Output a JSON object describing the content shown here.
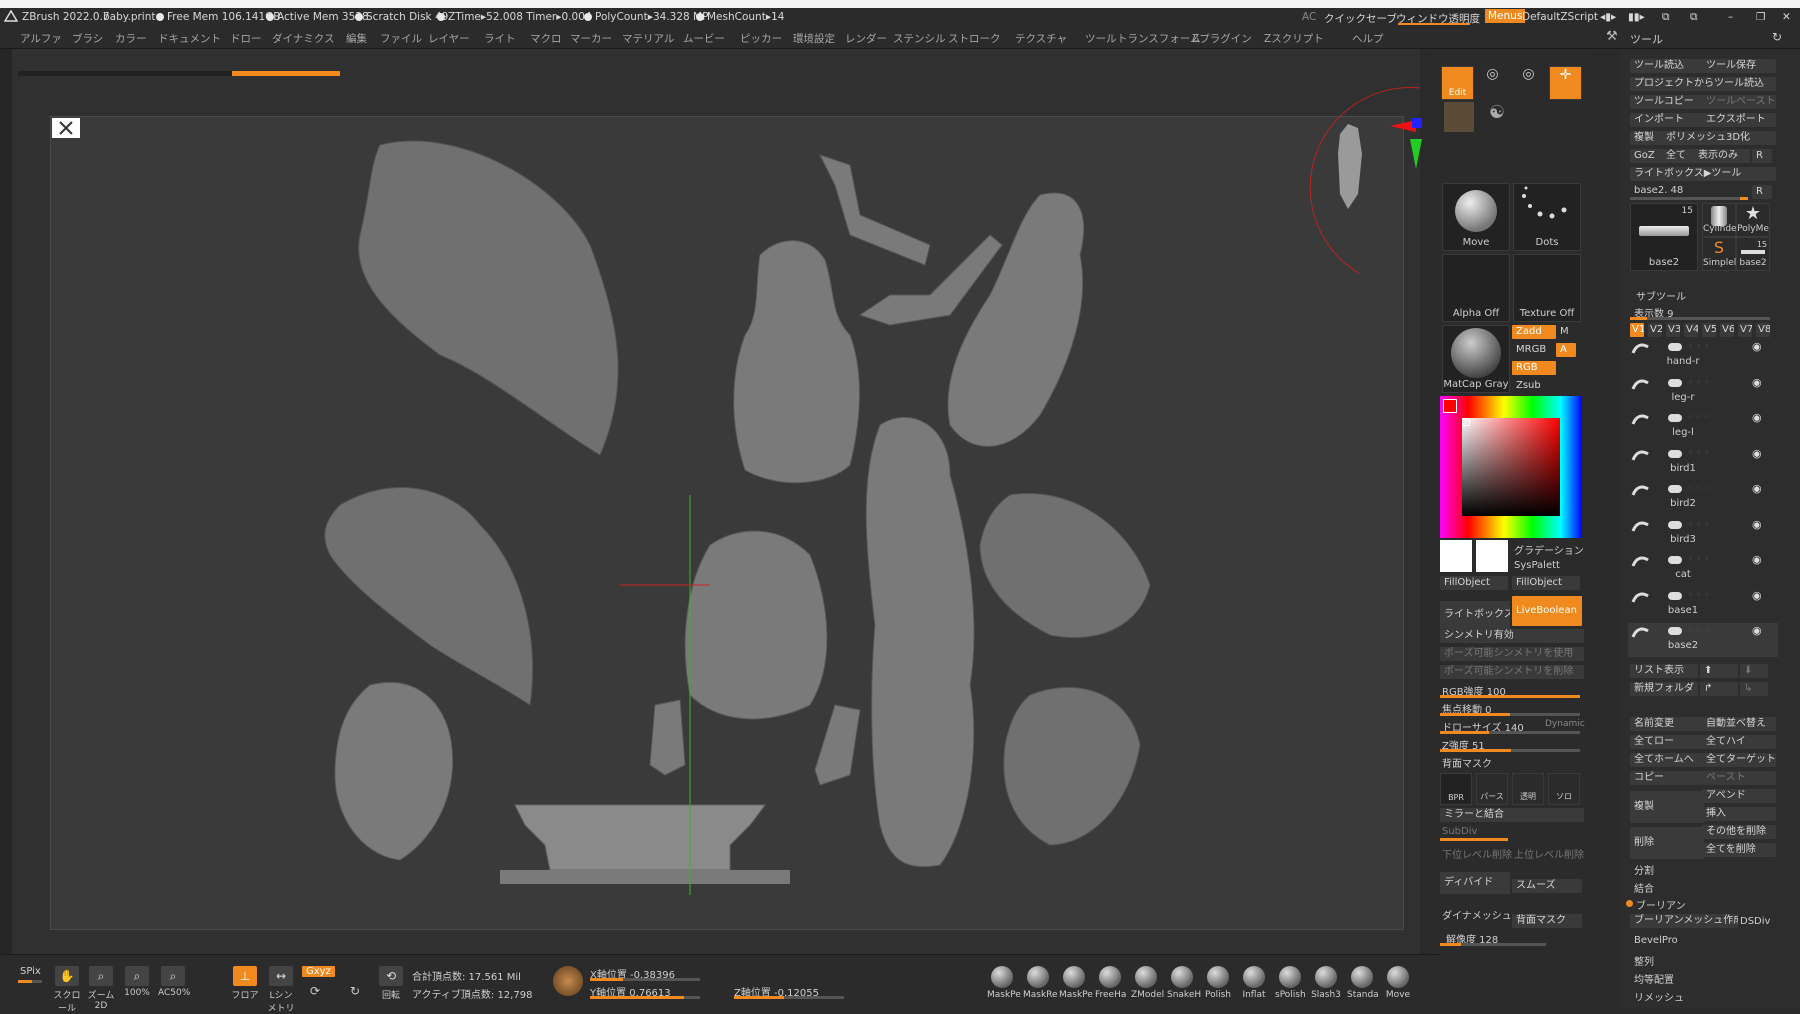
{
  "titlebar": {
    "app": "ZBrush 2022.0.7",
    "file": "baby.print",
    "stats": [
      "Free Mem 106.141GB",
      "Active Mem 3538",
      "Scratch Disk 49",
      "ZTime▸52.008 Timer▸0.004",
      "PolyCount▸34.328 MP",
      "MeshCount▸14"
    ],
    "ac": "AC",
    "quicksave": "クイックセーブ",
    "transparency": "ウィンドウ透明度",
    "menus_btn": "Menus",
    "script": "DefaultZScript"
  },
  "menubar": [
    "アルファ",
    "ブラシ",
    "カラー",
    "ドキュメント",
    "ドロー",
    "ダイナミクス",
    "編集",
    "ファイル",
    "レイヤー",
    "ライト",
    "マクロ",
    "マーカー",
    "マテリアル",
    "ムービー",
    "ピッカー",
    "環境設定",
    "レンダー",
    "ステンシル",
    "ストローク",
    "テクスチャ",
    "ツール",
    "トランスフォーム",
    "Zプラグイン",
    "Zスクリプト",
    "ヘルプ"
  ],
  "tool_panel_title": "ツール",
  "mid": {
    "edit": "Edit",
    "move_tile": "Move",
    "dots_tile": "Dots",
    "alpha_tile": "Alpha Off",
    "texture_tile": "Texture Off",
    "matcap_tile": "MatCap Gray",
    "zadd": "Zadd",
    "m": "M",
    "mrgb": "MRGB",
    "a": "A",
    "rgb": "RGB",
    "zsub": "Zsub",
    "gradation": "グラデーション",
    "syspalette": "SysPalett",
    "fillobject1": "FillObject",
    "fillobject2": "FillObject",
    "lightbox": "ライトボックス",
    "liveboolean": "LiveBoolean",
    "symmetry": "シンメトリ有効",
    "pose_sym_use": "ポーズ可能シンメトリを使用",
    "pose_sym_del": "ポーズ可能シンメトリを削除",
    "rgb_intensity": "RGB強度 100",
    "focal_shift": "焦点移動 0",
    "draw_size": "ドローサイズ 140",
    "dynamic": "Dynamic",
    "z_intensity": "Z強度 51",
    "backface_mask": "背面マスク",
    "bpr": "BPR",
    "perspective": "パース",
    "transparent": "透明",
    "solo": "ソロ",
    "mirror_merge": "ミラーと結合",
    "subdiv": "SubDiv",
    "lower_del": "下位レベル削除",
    "upper_del": "上位レベル削除",
    "divide": "ディバイド",
    "smooth": "スムーズ",
    "dynamesh": "ダイナメッシュ",
    "backface_mask2": "背面マスク",
    "resolution": "解像度 128"
  },
  "right": {
    "load_tool": "ツール読込",
    "save_tool": "ツール保存",
    "load_from_project": "プロジェクトからツール読込",
    "copy_tool": "ツールコピー",
    "paste_tool": "ツールペースト",
    "import": "インポート",
    "export": "エクスポート",
    "clone": "複製",
    "polymesh3d": "ポリメッシュ3D化",
    "goz": "GoZ",
    "all": "全て",
    "visible": "表示のみ",
    "r": "R",
    "lightbox_tool": "ライトボックス▶ツール",
    "current": "base2. 48",
    "thumbs": [
      {
        "name": "base2",
        "count": "15"
      },
      {
        "name": "Cylinde",
        "count": ""
      },
      {
        "name": "PolyMe",
        "count": ""
      },
      {
        "name": "Simplel",
        "count": ""
      },
      {
        "name": "base2",
        "count": "15"
      }
    ],
    "subtool_title": "サブツール",
    "display_count": "表示数 9",
    "versions": [
      "V1",
      "V2",
      "V3",
      "V4",
      "V5",
      "V6",
      "V7",
      "V8"
    ],
    "subtools": [
      "hand-r",
      "leg-r",
      "leg-l",
      "bird1",
      "bird2",
      "bird3",
      "cat",
      "base1",
      "base2"
    ],
    "list_display": "リスト表示",
    "new_folder": "新規フォルダ",
    "rename": "名前変更",
    "auto_reorder": "自動並べ替え",
    "all_low": "全てロー",
    "all_high": "全てハイ",
    "all_home": "全てホームへ",
    "all_target": "全てターゲット",
    "copy": "コピー",
    "paste": "ペースト",
    "duplicate": "複製",
    "append": "アペンド",
    "insert": "挿入",
    "delete": "削除",
    "delete_other": "その他を削除",
    "delete_all": "全てを削除",
    "split": "分割",
    "merge": "結合",
    "boolean": "ブーリアン",
    "boolean_mesh": "ブーリアンメッシュ作成",
    "dsdiv": "DSDiv",
    "bevelpro": "BevelPro",
    "align": "整列",
    "distribute": "均等配置",
    "remesh": "リメッシュ"
  },
  "bottom": {
    "spix": "SPix",
    "scroll": "スクロール",
    "zoom2d": "ズーム2D",
    "zoom100": "100%",
    "ac50": "AC50%",
    "floor": "フロア",
    "local_sym": "Lシンメトリ",
    "xyz": "Gxyz",
    "rotate": "回転",
    "total_points": "合計頂点数: 17.561 Mil",
    "active_points": "アクティブ頂点数: 12,798",
    "x_pos": "X軸位置 -0.38396",
    "y_pos": "Y軸位置 0.76613",
    "z_pos": "Z軸位置 -0.12055",
    "brushes": [
      "MaskPe",
      "MaskRe",
      "MaskPe",
      "FreeHa",
      "ZModel",
      "SnakeH",
      "Polish",
      "Inflat",
      "sPolish",
      "Slash3",
      "Standa",
      "Move"
    ]
  },
  "colors": {
    "accent": "#f08a1e",
    "canvas": "#3a3a3a",
    "panel": "#2b2b2b"
  }
}
